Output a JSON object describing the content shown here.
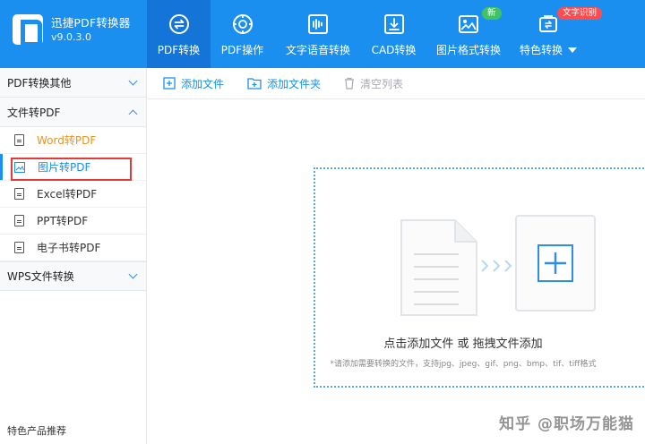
{
  "app": {
    "name": "迅捷PDF转换器",
    "version": "v9.0.3.0"
  },
  "nav": {
    "tabs": [
      {
        "label": "PDF转换",
        "icon": "pdf-convert-icon"
      },
      {
        "label": "PDF操作",
        "icon": "pdf-operate-icon"
      },
      {
        "label": "文字语音转换",
        "icon": "audio-wave-icon"
      },
      {
        "label": "CAD转换",
        "icon": "cad-icon"
      },
      {
        "label": "图片格式转换",
        "icon": "image-icon",
        "badge": "新"
      },
      {
        "label": "特色转换",
        "icon": "special-convert-icon",
        "badge": "文字识别"
      }
    ]
  },
  "sidebar": {
    "sections": [
      {
        "label": "PDF转换其他",
        "expanded": false
      },
      {
        "label": "文件转PDF",
        "expanded": true
      },
      {
        "label": "WPS文件转换",
        "expanded": false
      }
    ],
    "items": [
      {
        "label": "Word转PDF"
      },
      {
        "label": "图片转PDF"
      },
      {
        "label": "Excel转PDF"
      },
      {
        "label": "PPT转PDF"
      },
      {
        "label": "电子书转PDF"
      }
    ],
    "footer": "特色产品推荐"
  },
  "toolbar": {
    "add_file": "添加文件",
    "add_folder": "添加文件夹",
    "clear_list": "清空列表"
  },
  "dropzone": {
    "title": "点击添加文件 或 拖拽文件添加",
    "subtitle": "*请添加需要转换的文件，支持jpg、jpeg、gif、png、bmp、tif、tiff格式"
  },
  "watermark": "知乎 @职场万能猫",
  "colors": {
    "brand": "#1b8ff0",
    "active_tab": "#1574d8",
    "highlight_box": "#e23b3b",
    "orange_text": "#e89324"
  }
}
